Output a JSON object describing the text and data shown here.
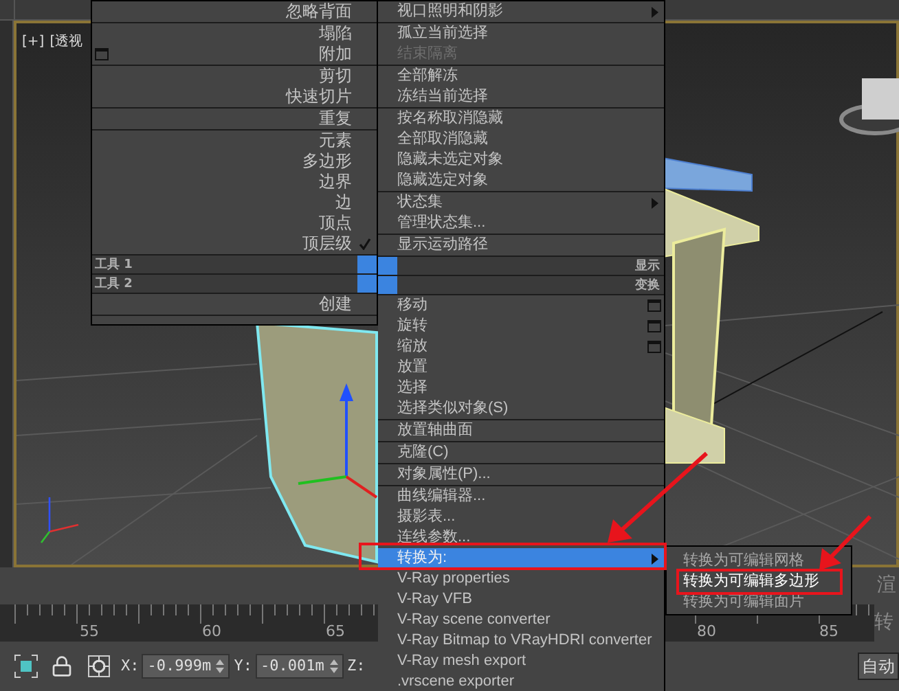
{
  "viewport": {
    "label_plus": "[+]",
    "label_view": "[透视"
  },
  "quad_menu": {
    "left": [
      {
        "kind": "section",
        "items": [
          {
            "label": "忽略背面",
            "kind": "plain"
          }
        ]
      },
      {
        "kind": "section",
        "items": [
          {
            "label": "塌陷",
            "kind": "plain"
          },
          {
            "label": "附加",
            "kind": "window"
          }
        ]
      },
      {
        "kind": "section",
        "items": [
          {
            "label": "剪切",
            "kind": "plain"
          },
          {
            "label": "快速切片",
            "kind": "plain"
          }
        ]
      },
      {
        "kind": "section",
        "items": [
          {
            "label": "重复",
            "kind": "plain"
          }
        ]
      },
      {
        "kind": "section",
        "items": [
          {
            "label": "元素",
            "kind": "plain",
            "checked": false
          },
          {
            "label": "多边形",
            "kind": "plain",
            "checked": false
          },
          {
            "label": "边界",
            "kind": "plain",
            "checked": false
          },
          {
            "label": "边",
            "kind": "plain",
            "checked": false
          },
          {
            "label": "顶点",
            "kind": "plain",
            "checked": false
          },
          {
            "label": "顶层级",
            "kind": "plain",
            "checked": true
          }
        ]
      },
      {
        "kind": "header",
        "label": "工具 1"
      },
      {
        "kind": "header",
        "label": "工具 2"
      },
      {
        "kind": "section",
        "items": [
          {
            "label": "创建",
            "kind": "plain"
          }
        ]
      }
    ],
    "right": [
      {
        "kind": "section",
        "items": [
          {
            "label": "视口照明和阴影",
            "kind": "submenu"
          }
        ]
      },
      {
        "kind": "section",
        "items": [
          {
            "label": "孤立当前选择",
            "kind": "plain",
            "disabled": false
          },
          {
            "label": "结束隔离",
            "kind": "plain",
            "disabled": true
          }
        ]
      },
      {
        "kind": "section",
        "items": [
          {
            "label": "全部解冻",
            "kind": "plain"
          },
          {
            "label": "冻结当前选择",
            "kind": "plain"
          }
        ]
      },
      {
        "kind": "section",
        "items": [
          {
            "label": "按名称取消隐藏",
            "kind": "plain"
          },
          {
            "label": "全部取消隐藏",
            "kind": "plain"
          },
          {
            "label": "隐藏未选定对象",
            "kind": "plain"
          },
          {
            "label": "隐藏选定对象",
            "kind": "plain"
          }
        ]
      },
      {
        "kind": "section",
        "items": [
          {
            "label": "状态集",
            "kind": "submenu"
          },
          {
            "label": "管理状态集...",
            "kind": "plain"
          }
        ]
      },
      {
        "kind": "section",
        "items": [
          {
            "label": "显示运动路径",
            "kind": "plain"
          }
        ]
      },
      {
        "kind": "header",
        "label": "显示"
      },
      {
        "kind": "header",
        "label": "变换"
      },
      {
        "kind": "section",
        "items": [
          {
            "label": "移动",
            "kind": "options"
          },
          {
            "label": "旋转",
            "kind": "options"
          },
          {
            "label": "缩放",
            "kind": "options"
          },
          {
            "label": "放置",
            "kind": "plain"
          },
          {
            "label": "选择",
            "kind": "plain"
          },
          {
            "label": "选择类似对象(S)",
            "kind": "plain"
          }
        ]
      },
      {
        "kind": "section",
        "items": [
          {
            "label": "放置轴曲面",
            "kind": "plain"
          }
        ]
      },
      {
        "kind": "section",
        "items": [
          {
            "label": "克隆(C)",
            "kind": "plain"
          }
        ]
      },
      {
        "kind": "section",
        "items": [
          {
            "label": "对象属性(P)...",
            "kind": "plain"
          }
        ]
      },
      {
        "kind": "section",
        "items": [
          {
            "label": "曲线编辑器...",
            "kind": "plain",
            "selected": false
          },
          {
            "label": "摄影表...",
            "kind": "plain",
            "selected": false
          },
          {
            "label": "连线参数...",
            "kind": "plain",
            "selected": false
          },
          {
            "label": "转换为:",
            "kind": "submenu",
            "selected": true
          },
          {
            "label": "V-Ray properties",
            "kind": "plain",
            "selected": false
          },
          {
            "label": "V-Ray VFB",
            "kind": "plain",
            "selected": false
          },
          {
            "label": "V-Ray scene converter",
            "kind": "plain",
            "selected": false
          },
          {
            "label": "V-Ray Bitmap to VRayHDRI converter",
            "kind": "plain",
            "selected": false
          },
          {
            "label": "V-Ray mesh export",
            "kind": "plain",
            "selected": false
          },
          {
            "label": ".vrscene exporter",
            "kind": "plain",
            "selected": false
          }
        ]
      }
    ],
    "submenu": [
      {
        "label": "转换为可编辑网格",
        "selected": false
      },
      {
        "label": "转换为可编辑多边形",
        "selected": true
      },
      {
        "label": "转换为可编辑面片",
        "selected": false
      }
    ]
  },
  "side_panel": {
    "text_1": "渲",
    "text_2": "转"
  },
  "timeline": {
    "labels": [
      "55",
      "60",
      "65",
      "80",
      "85"
    ]
  },
  "status_bar": {
    "coords": [
      {
        "axis": "X:",
        "value": "-0.999m"
      },
      {
        "axis": "Y:",
        "value": "-0.001m"
      },
      {
        "axis": "Z:"
      }
    ],
    "auto_button": "自动"
  }
}
